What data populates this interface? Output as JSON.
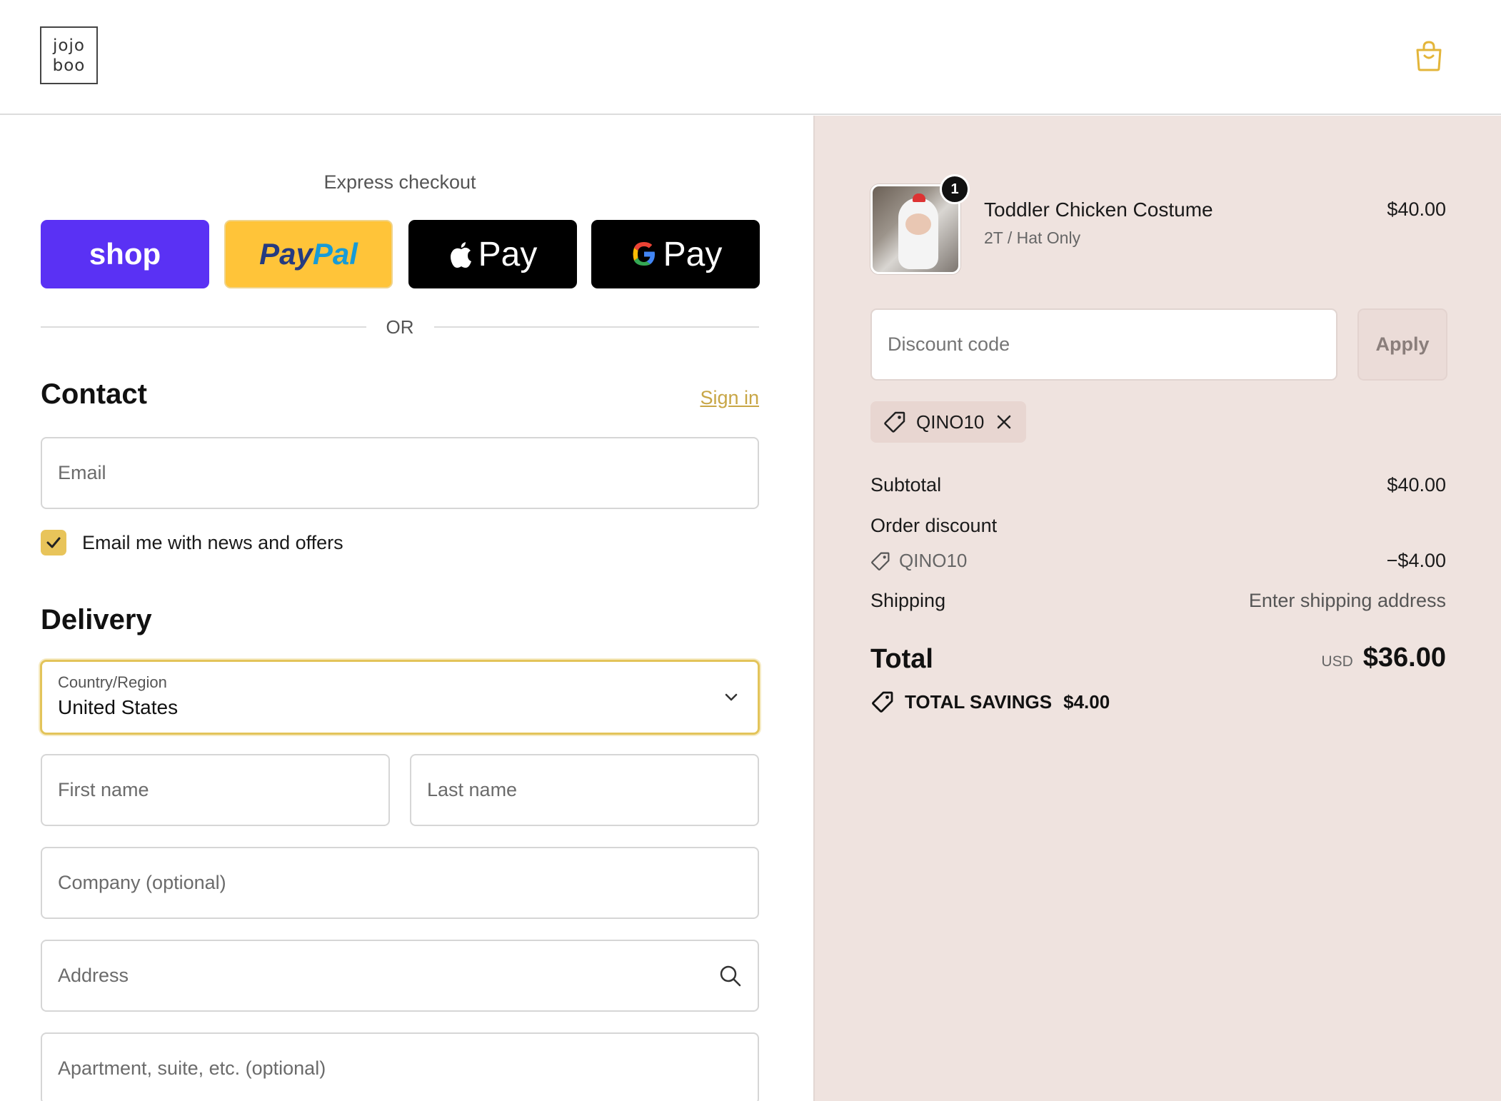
{
  "header": {
    "logo_line1": "jojo",
    "logo_line2": "boo"
  },
  "express": {
    "label": "Express checkout",
    "shop_label": "shop",
    "paypal_pay": "Pay",
    "paypal_pal": "Pal",
    "applepay_label": "Pay",
    "gpay_g": "G",
    "gpay_label": "Pay",
    "or_text": "OR"
  },
  "contact": {
    "title": "Contact",
    "signin_label": "Sign in",
    "email_placeholder": "Email",
    "newsletter_label": "Email me with news and offers",
    "newsletter_checked": true
  },
  "delivery": {
    "title": "Delivery",
    "country_label": "Country/Region",
    "country_value": "United States",
    "first_name_placeholder": "First name",
    "last_name_placeholder": "Last name",
    "company_placeholder": "Company (optional)",
    "address_placeholder": "Address",
    "apartment_placeholder": "Apartment, suite, etc. (optional)"
  },
  "summary": {
    "item": {
      "name": "Toddler Chicken Costume",
      "variant": "2T / Hat Only",
      "price": "$40.00",
      "quantity": "1"
    },
    "discount_placeholder": "Discount code",
    "apply_label": "Apply",
    "applied_code": "QINO10",
    "subtotal_label": "Subtotal",
    "subtotal_value": "$40.00",
    "order_discount_label": "Order discount",
    "discount_code": "QINO10",
    "discount_value": "−$4.00",
    "shipping_label": "Shipping",
    "shipping_value": "Enter shipping address",
    "total_label": "Total",
    "total_currency": "USD",
    "total_value": "$36.00",
    "savings_label": "TOTAL SAVINGS",
    "savings_value": "$4.00"
  },
  "colors": {
    "accent": "#e3c45a",
    "shop_pay": "#5a31f4",
    "paypal": "#ffc439",
    "summary_bg": "#efe3df"
  }
}
